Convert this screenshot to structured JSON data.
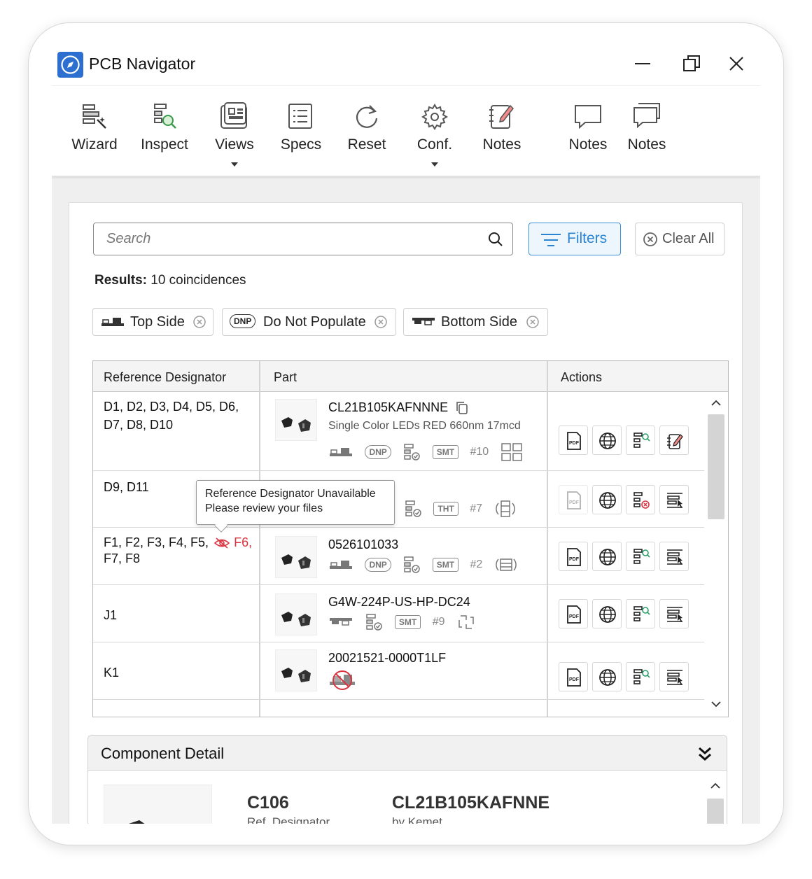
{
  "app": {
    "title": "PCB Navigator"
  },
  "toolbar": {
    "items": [
      {
        "label": "Wizard",
        "icon": "wizard-icon"
      },
      {
        "label": "Inspect",
        "icon": "inspect-icon"
      },
      {
        "label": "Views",
        "icon": "views-icon",
        "dropdown": true
      },
      {
        "label": "Specs",
        "icon": "specs-icon"
      },
      {
        "label": "Reset",
        "icon": "reset-icon"
      },
      {
        "label": "Conf.",
        "icon": "gear-icon",
        "dropdown": true
      },
      {
        "label": "Notes",
        "icon": "notes-edit-icon"
      },
      {
        "label": "Notes",
        "icon": "comment-icon"
      },
      {
        "label": "Notes",
        "icon": "comments-icon"
      }
    ]
  },
  "search": {
    "placeholder": "Search"
  },
  "filters_button": {
    "label": "Filters"
  },
  "clear_button": {
    "label": "Clear All"
  },
  "results": {
    "label": "Results:",
    "value": "10 coincidences"
  },
  "chips": [
    {
      "label": "Top Side",
      "icon": "top-side-icon"
    },
    {
      "label": "Do Not Populate",
      "icon": "dnp-icon",
      "badge": "DNP"
    },
    {
      "label": "Bottom Side",
      "icon": "bottom-side-icon"
    }
  ],
  "table": {
    "headers": {
      "ref": "Reference Designator",
      "part": "Part",
      "actions": "Actions"
    },
    "rows": [
      {
        "ref_line1": "D1, D2, D3, D4, D5, D6,",
        "ref_line2": "D7, D8, D10",
        "part": "CL21B105KAFNNNE",
        "desc": "Single Color LEDs RED 660nm 17mcd",
        "tags": [
          "DNP",
          "SMT"
        ],
        "count": "#10"
      },
      {
        "ref_line1": "D9, D11",
        "ref_line2": "",
        "part": "",
        "desc": "",
        "tags": [
          "THT"
        ],
        "count": "#7"
      },
      {
        "ref_line1": "F1, F2, F3, F4, F5,",
        "ref_hidden": "F6,",
        "ref_line2": "F7, F8",
        "part": "0526101033",
        "tags": [
          "DNP",
          "SMT"
        ],
        "count": "#2"
      },
      {
        "ref_line1": "J1",
        "part": "G4W-224P-US-HP-DC24",
        "tags": [
          "SMT"
        ],
        "count": "#9"
      },
      {
        "ref_line1": "K1",
        "part": "20021521-0000T1LF",
        "tags": []
      }
    ],
    "tooltip": {
      "line1": "Reference Designator Unavailable",
      "line2": "Please review your files"
    },
    "action_icons": [
      "pdf-icon",
      "globe-icon",
      "inspect-list-icon",
      "notes-icon"
    ],
    "pdf_label": "PDF"
  },
  "detail": {
    "title": "Component Detail",
    "ref": "C106",
    "ref_label": "Ref. Designator",
    "part": "CL21B105KAFNNE",
    "by": "by Kemet"
  },
  "colors": {
    "accent": "#2b84d2",
    "warning": "#d9343f",
    "app_icon": "#2d6fd1"
  }
}
